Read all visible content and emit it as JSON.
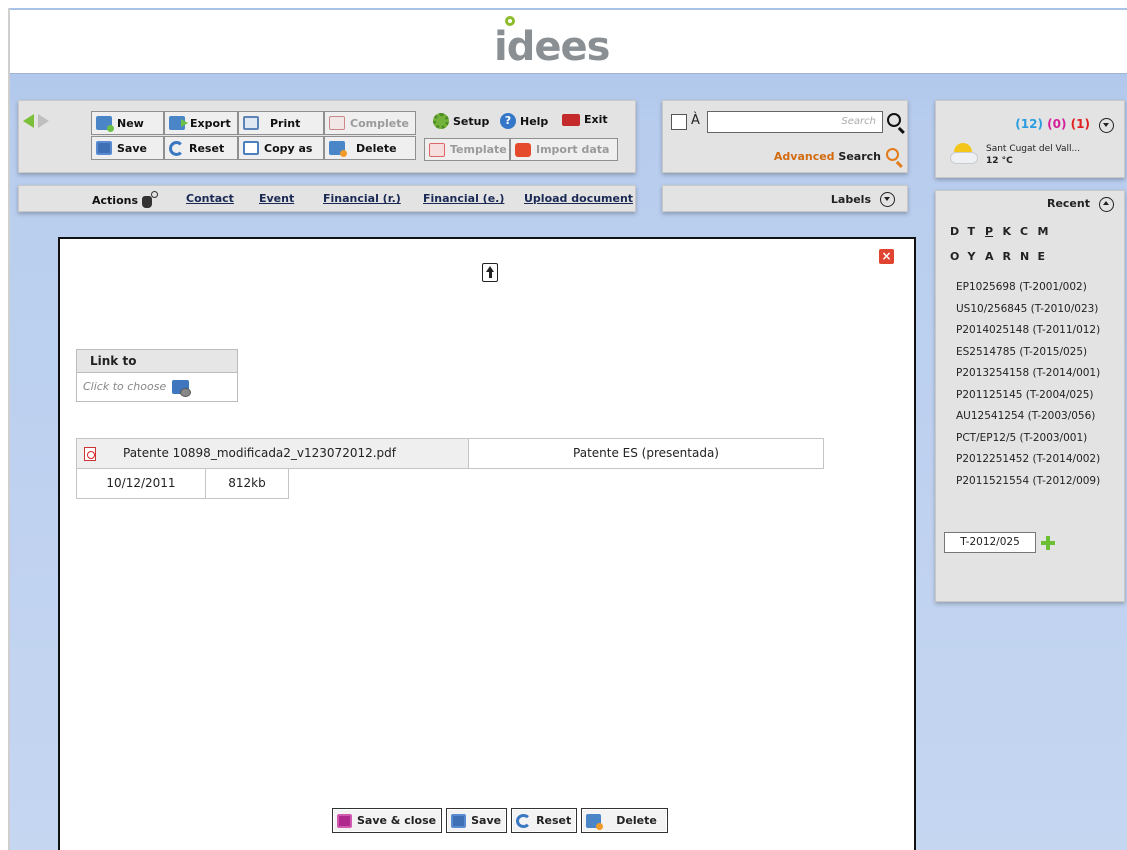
{
  "header": {
    "logo_text": "idees"
  },
  "toolbar": {
    "new": "New",
    "save": "Save",
    "export": "Export",
    "reset": "Reset",
    "print": "Print",
    "copy_as": "Copy as",
    "complete": "Complete",
    "delete": "Delete",
    "setup": "Setup",
    "help": "Help",
    "exit": "Exit",
    "template": "Template",
    "import_data": "Import data"
  },
  "search": {
    "a_label": "À",
    "placeholder": "Search",
    "advanced": "Advanced",
    "search_label": "Search"
  },
  "tabs": {
    "actions": "Actions",
    "contact": "Contact",
    "event": "Event",
    "financial_r": "Financial (r.)",
    "financial_e": "Financial (e.)",
    "upload_document": "Upload document"
  },
  "labels": {
    "title": "Labels"
  },
  "weather": {
    "count_blue": "(12)",
    "count_pink": "(0)",
    "count_red": "(1)",
    "city": "Sant Cugat del Vall...",
    "temp": "12 °C"
  },
  "recent": {
    "title": "Recent",
    "letters_row1": [
      "D",
      "T",
      "P",
      "K",
      "C",
      "M"
    ],
    "letters_row2": [
      "O",
      "Y",
      "A",
      "R",
      "N",
      "E"
    ],
    "items": [
      "EP1025698 (T-2001/002)",
      "US10/256845 (T-2010/023)",
      "P2014025148 (T-2011/012)",
      "ES2514785 (T-2015/025)",
      "P2013254158 (T-2014/001)",
      "P201125145 (T-2004/025)",
      "AU12541254 (T-2003/056)",
      "PCT/EP12/5 (T-2003/001)",
      "P2012251452 (T-2014/002)",
      "P2011521554 (T-2012/009)"
    ],
    "input_value": "T-2012/025"
  },
  "modal": {
    "link_to_title": "Link to",
    "click_to_choose": "Click to choose",
    "file": {
      "name": "Patente 10898_modificada2_v123072012.pdf",
      "description": "Patente ES (presentada)",
      "date": "10/12/2011",
      "size": "812kb"
    },
    "buttons": {
      "save_close": "Save & close",
      "save": "Save",
      "reset": "Reset",
      "delete": "Delete"
    }
  },
  "colors": {
    "accent_green": "#7bbf3a",
    "count_blue": "#2a9de0",
    "count_pink": "#d41e9a",
    "count_red": "#e02020",
    "advanced_orange": "#d36b10"
  }
}
